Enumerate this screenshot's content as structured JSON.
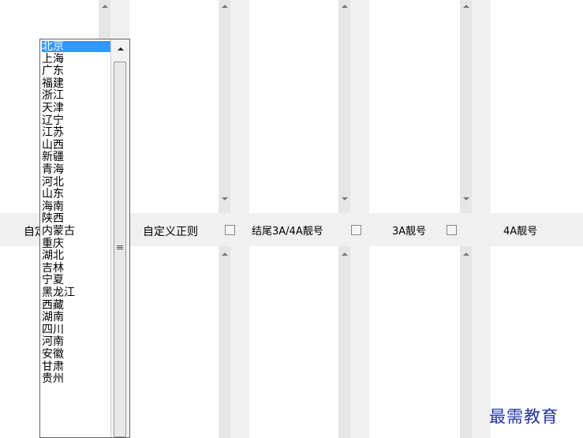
{
  "columns": [
    {
      "label": "自定义正则"
    },
    {
      "label": "结尾3A/4A靓号"
    },
    {
      "label": "3A靓号"
    },
    {
      "label": "4A靓号"
    }
  ],
  "first_label_partial": "自定",
  "dropdown": {
    "selected": "北京",
    "options": [
      "北京",
      "上海",
      "广东",
      "福建",
      "浙江",
      "天津",
      "辽宁",
      "江苏",
      "山西",
      "新疆",
      "青海",
      "河北",
      "山东",
      "海南",
      "陕西",
      "内蒙古",
      "重庆",
      "湖北",
      "吉林",
      "宁夏",
      "黑龙江",
      "西藏",
      "湖南",
      "四川",
      "河南",
      "安徽",
      "甘肃",
      "贵州"
    ]
  },
  "watermark": "最需教育",
  "colors": {
    "highlight": "#3399ff",
    "watermark": "#2233aa"
  }
}
